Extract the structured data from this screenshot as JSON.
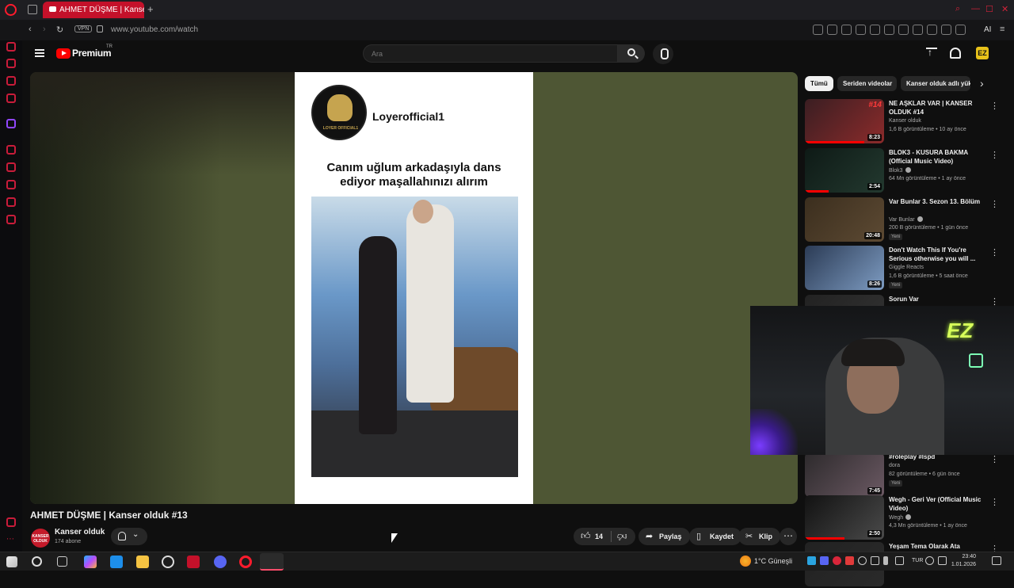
{
  "browser": {
    "tab_title": "AHMET DÜŞME | Kanser",
    "vpn_label": "VPN",
    "url": "www.youtube.com/watch",
    "ai_label": "AI"
  },
  "youtube": {
    "logo_text": "Premium",
    "logo_region": "TR",
    "search_placeholder": "Ara"
  },
  "video": {
    "overlay_channel": "Loyerofficial1",
    "overlay_logo_text": "LOYER OFFICIAL1",
    "overlay_caption_line1": "Canım uğlum arkadaşıyla dans",
    "overlay_caption_line2": "ediyor maşallahınızı alırım",
    "title": "AHMET DÜŞME | Kanser olduk #13",
    "channel_name": "Kanser olduk",
    "channel_avatar_text": "KANSER OLDUK",
    "subscribers": "174 abone",
    "like_count": "14",
    "share_label": "Paylaş",
    "save_label": "Kaydet",
    "clip_label": "Klip"
  },
  "chips": [
    "Tümü",
    "Seriden videolar",
    "Kanser olduk adlı yük"
  ],
  "recommended": [
    {
      "title": "NE AŞKLAR VAR | KANSER OLDUK #14",
      "channel": "Kanser olduk",
      "meta": "1,6 B görüntüleme • 10 ay önce",
      "duration": "8:23",
      "badge": "#14",
      "thumb_colors": [
        "#3a1e22",
        "#8c2b2b"
      ],
      "verified": false,
      "new": false,
      "progress": 0.75
    },
    {
      "title": "BLOK3 - KUSURA BAKMA (Official Music Video)",
      "channel": "Blok3",
      "meta": "64 Mn görüntüleme • 1 ay önce",
      "duration": "2:54",
      "badge": "",
      "thumb_colors": [
        "#0e1a16",
        "#23392f"
      ],
      "verified": true,
      "new": false,
      "progress": 0.3
    },
    {
      "title": "Var Bunlar 3. Sezon 13. Bölüm",
      "channel": "Var Bunlar",
      "meta": "200 B görüntüleme • 1 gün önce",
      "duration": "20:48",
      "badge": "",
      "thumb_colors": [
        "#3b2e1e",
        "#5d4a33"
      ],
      "verified": true,
      "new": true,
      "new_label": "Yeni",
      "progress": 0
    },
    {
      "title": "Don't Watch This If You're Serious otherwise you will ...",
      "channel": "Giggle Reacts",
      "meta": "1,6 B görüntüleme • 5 saat önce",
      "duration": "8:26",
      "badge": "",
      "thumb_colors": [
        "#2b3b55",
        "#7d9bc1"
      ],
      "verified": false,
      "new": true,
      "new_label": "Yeni",
      "progress": 0
    },
    {
      "title": "Sorun Var",
      "channel": "",
      "meta": "",
      "duration": "",
      "badge": "",
      "thumb_colors": [
        "#222",
        "#333"
      ],
      "verified": false,
      "new": false,
      "progress": 0
    },
    {
      "title": "#roleplay #lspd",
      "channel": "dora",
      "meta": "82 görüntüleme • 6 gün önce",
      "duration": "7:45",
      "badge": "",
      "thumb_colors": [
        "#2d2a2c",
        "#6b5963"
      ],
      "verified": false,
      "new": true,
      "new_label": "Yeni",
      "progress": 0
    },
    {
      "title": "Wegh - Geri Ver (Official Music Video)",
      "channel": "Wegh",
      "meta": "4,3 Mn görüntüleme • 1 ay önce",
      "duration": "2:50",
      "badge": "",
      "thumb_colors": [
        "#121212",
        "#4a4a4a"
      ],
      "verified": true,
      "new": false,
      "progress": 0.5
    },
    {
      "title": "Yeşam Tema Olarak Ata",
      "channel": "",
      "meta": "",
      "duration": "",
      "badge": "",
      "thumb_colors": [
        "#222",
        "#2a2a2a"
      ],
      "verified": false,
      "new": false,
      "progress": 0
    }
  ],
  "webcam": {
    "neon_text": "EZ"
  },
  "taskbar": {
    "weather": "1°C  Güneşli",
    "language": "TUR",
    "time": "23:40",
    "date": "1.01.2026"
  }
}
